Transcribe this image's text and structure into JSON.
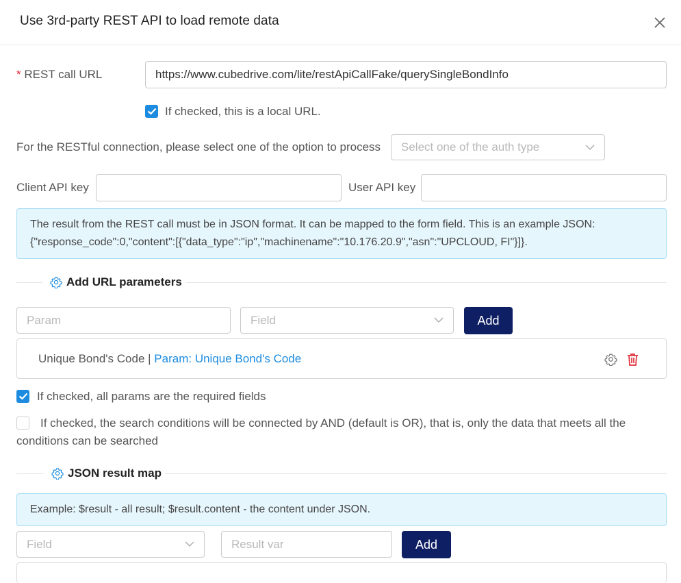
{
  "dialog": {
    "title": "Use 3rd-party REST API to load remote data"
  },
  "rest_url": {
    "required_mark": "*",
    "label": "REST call URL",
    "value": "https://www.cubedrive.com/lite/restApiCallFake/querySingleBondInfo"
  },
  "local_url": {
    "checked": true,
    "label": "If checked, this is a local URL."
  },
  "auth": {
    "label": "For the RESTful connection, please select one of the option to process",
    "placeholder": "Select one of the auth type"
  },
  "keys": {
    "client_label": "Client API key",
    "client_value": "",
    "user_label": "User API key",
    "user_value": ""
  },
  "info_json": {
    "line1": "The result from the REST call must be in JSON format. It can be mapped to the form field. This is an example JSON:",
    "line2": "{\"response_code\":0,\"content\":[{\"data_type\":\"ip\",\"machinename\":\"10.176.20.9\",\"asn\":\"UPCLOUD, FI\"}]}."
  },
  "url_params": {
    "section_title": "Add URL parameters",
    "param_placeholder": "Param",
    "field_placeholder": "Field",
    "add_label": "Add",
    "items": [
      {
        "field": "Unique Bond's Code",
        "separator": " | ",
        "param": "Param: Unique Bond's Code"
      }
    ],
    "required_checked": true,
    "required_label": "If checked, all params are the required fields",
    "and_checked": false,
    "and_label_line1": "If checked, the search conditions will be connected by AND (default is OR), that is, only the data that meets all the",
    "and_label_line2": "conditions can be searched"
  },
  "json_map": {
    "section_title": "JSON result map",
    "example": "Example: $result - all result; $result.content - the content under JSON.",
    "field_placeholder": "Field",
    "result_placeholder": "Result var",
    "add_label": "Add"
  },
  "colors": {
    "primary_button": "#0f1f63",
    "link": "#1d8ce0",
    "info_bg": "#e6f6fd",
    "required": "#e0303a",
    "delete": "#e0303a"
  }
}
